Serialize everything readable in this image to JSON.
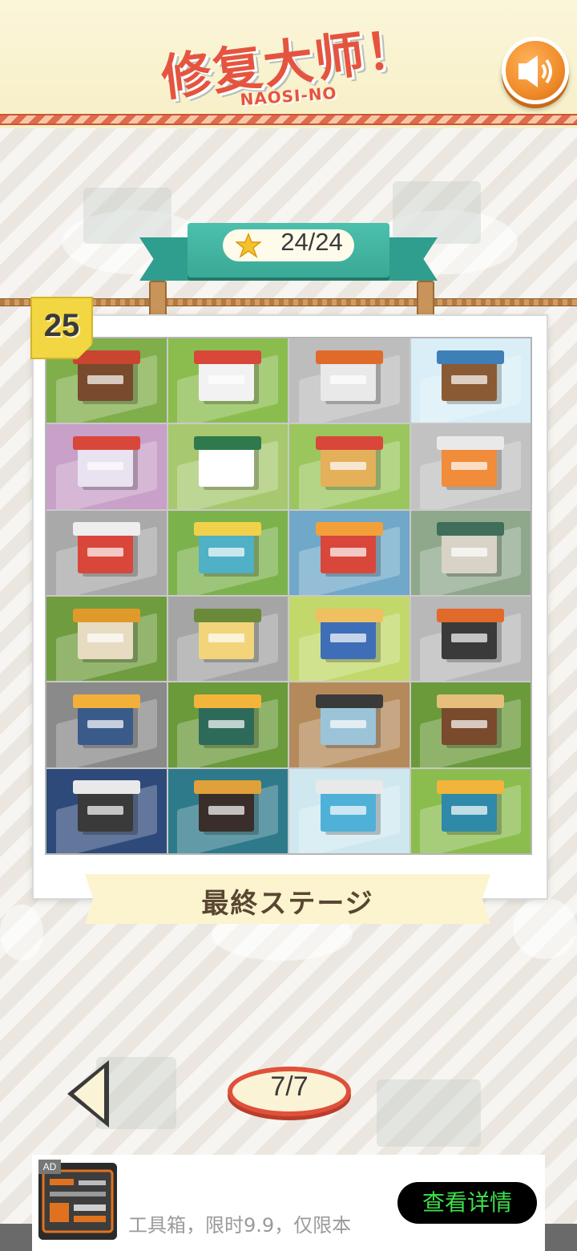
{
  "header": {
    "logo_main": "修复大师！",
    "logo_sub": "NAOSI-NO",
    "sound_icon": "speaker-icon"
  },
  "banner": {
    "star_icon": "star-icon",
    "stars": "24/24"
  },
  "stage": {
    "number": "25",
    "label": "最終ステージ",
    "tiles": [
      {
        "name": "coffee-shop",
        "ground": "#7fae4a",
        "body": "#7a4a2c",
        "roof": "#c9452f"
      },
      {
        "name": "burger-shop",
        "ground": "#8bbd4e",
        "body": "#f2f2f2",
        "roof": "#d9473a"
      },
      {
        "name": "gas-station",
        "ground": "#bdbdbd",
        "body": "#e9e9e9",
        "roof": "#e06a2a"
      },
      {
        "name": "snow-cabin",
        "ground": "#d9eef7",
        "body": "#8a5a34",
        "roof": "#3f7fb8"
      },
      {
        "name": "arcade",
        "ground": "#c8a0c8",
        "body": "#e9e2f0",
        "roof": "#d9473a"
      },
      {
        "name": "flower-shop",
        "ground": "#a8c870",
        "body": "#ffffff",
        "roof": "#2e7a4c"
      },
      {
        "name": "circus-tent",
        "ground": "#9bc65e",
        "body": "#e4b05a",
        "roof": "#d9473a"
      },
      {
        "name": "convenience-store",
        "ground": "#c2c2c2",
        "body": "#f08c3a",
        "roof": "#e9e9e9"
      },
      {
        "name": "post-office",
        "ground": "#a9a9a9",
        "body": "#d9473a",
        "roof": "#eeeeee"
      },
      {
        "name": "power-plant",
        "ground": "#7cb24c",
        "body": "#4fb0c6",
        "roof": "#f2d14a"
      },
      {
        "name": "night-market",
        "ground": "#6fa8c8",
        "body": "#d9473a",
        "roof": "#f2a03a"
      },
      {
        "name": "farmhouse",
        "ground": "#8fa88c",
        "body": "#d8d3c6",
        "roof": "#3f6e5a"
      },
      {
        "name": "barn",
        "ground": "#6f9c3e",
        "body": "#e7dcc2",
        "roof": "#e09a2a"
      },
      {
        "name": "cheese-shop",
        "ground": "#a5a5a5",
        "body": "#f2d47a",
        "roof": "#6a8a3a"
      },
      {
        "name": "bakery",
        "ground": "#c2d86a",
        "body": "#3f6eb8",
        "roof": "#f0c060"
      },
      {
        "name": "diner",
        "ground": "#b8b8b8",
        "body": "#3a3a3a",
        "roof": "#e06a2a"
      },
      {
        "name": "office-building",
        "ground": "#8a8a8a",
        "body": "#3a5a8a",
        "roof": "#f2b03a"
      },
      {
        "name": "tea-garden",
        "ground": "#6a9a3a",
        "body": "#2e6a5a",
        "roof": "#f2b43a"
      },
      {
        "name": "bank",
        "ground": "#b58a5a",
        "body": "#9cc4d8",
        "roof": "#3a3a3a"
      },
      {
        "name": "sushi-bar",
        "ground": "#6a9a3a",
        "body": "#7a4a2c",
        "roof": "#e6c07a"
      },
      {
        "name": "cinema",
        "ground": "#2e4a7a",
        "body": "#3a3a3a",
        "roof": "#e9e9e9"
      },
      {
        "name": "record-shop",
        "ground": "#2e7a8a",
        "body": "#3a2e2a",
        "roof": "#e0a03a"
      },
      {
        "name": "aquarium",
        "ground": "#cfe8f0",
        "body": "#4fb0d8",
        "roof": "#e9e9e9"
      },
      {
        "name": "toy-factory",
        "ground": "#8bbd4e",
        "body": "#2e8aa8",
        "roof": "#f2b43a"
      }
    ]
  },
  "navigation": {
    "prev_icon": "triangle-left-icon",
    "page": "7/7"
  },
  "ad": {
    "tag": "AD",
    "text": "工具箱，限时9.9，仅限本",
    "cta": "查看详情"
  }
}
